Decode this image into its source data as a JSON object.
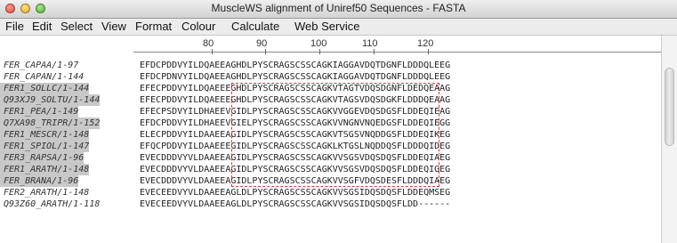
{
  "window": {
    "title": "MuscleWS alignment of Uniref50 Sequences - FASTA"
  },
  "menu": [
    "File",
    "Edit",
    "Select",
    "View",
    "Format",
    "Colour",
    "Calculate",
    "Web Service"
  ],
  "ruler": [
    "80",
    "90",
    "100",
    "110",
    "120"
  ],
  "sequences": [
    {
      "id": "FER_CAPAA/1-97",
      "seq": "EFDCPDDVYILDQAEEAGHDLPYSCRAGSCSSCAGKIAGGAVDQTDGNFLDDDQLEEG"
    },
    {
      "id": "FER_CAPAN/1-144",
      "seq": "EFDCPDNVYILDQAEEAGHDLPYSCRAGSCSSCAGKIAGGAVDQTDGNFLDDDQLEEG"
    },
    {
      "id": "FER1_SOLLC/1-144",
      "seq": "EFECPDDVYILDQAEEEGHDLPYSCRAGSCSSCAGKVTAGTVDQSDGNFLDEDQEAAG"
    },
    {
      "id": "Q93XJ9_SOLTU/1-144",
      "seq": "EFECPDDVYILDQAEEEGHDLPYSCRAGSCSSCAGKVTAGSVDQSDGKFLDDDQEAAG"
    },
    {
      "id": "FER1_PEA/1-149",
      "seq": "EFECPSDVYILDHAEEVGIDLPYSCRAGSCSSCAGKVVGGEVDQSDGSFLDDEQIEAG"
    },
    {
      "id": "Q7XA98_TRIPR/1-152",
      "seq": "EFDCPDDVYILDHAEEVGIELPYSCRAGSCSSCAGKVVNGNVNQEDGSFLDDEQIEGG"
    },
    {
      "id": "FER1_MESCR/1-148",
      "seq": "ELECPDDVYILDAAEEAGIDLPYSCRAGSCSSCAGKVTSGSVNQDDGSFLDDEQIKEG"
    },
    {
      "id": "FER1_SPIOL/1-147",
      "seq": "EFQCPDDVYILDAAEEEGIDLPYSCRAGSCSSCAGKLKTGSLNQDDQSFLDDDQIDEG"
    },
    {
      "id": "FER3_RAPSA/1-96",
      "seq": "EVECDDDVYVLDAAEEAGIDLPYSCRAGSCSSCAGKVVSGSVDQSDQSFLDDEQIAEG"
    },
    {
      "id": "FER1_ARATH/1-148",
      "seq": "EVECDDDVYVLDAAEEAGIDLPYSCRAGSCSSCAGKVVSGSVDQSDQSFLDDEQIGEG"
    },
    {
      "id": "FER_BRANA/1-96",
      "seq": "EVECDDDVYVLDAAEEAGIDLPYSCRAGSCSSCAGKVVSGFVDQSDESFLDDDQIAEG"
    },
    {
      "id": "FER2_ARATH/1-148",
      "seq": "EVECEEDVYVLDAAEEAGLDLPYSCRAGSCSSCAGKVVSGSIDQSDQSFLDDEQMSEG"
    },
    {
      "id": "Q93Z60_ARATH/1-118",
      "seq": "EVECEEDVYVLDAAEEAGLDLPYSCRAGSCSSCAGKVVSGSIDQSDQSFLDD------"
    }
  ],
  "selected_ids": [
    2,
    3,
    4,
    5,
    6,
    7,
    8,
    9,
    10
  ],
  "colors": {
    "selection_outline": "#d23a3a",
    "id_selection_bg": "#c8c8c8"
  }
}
